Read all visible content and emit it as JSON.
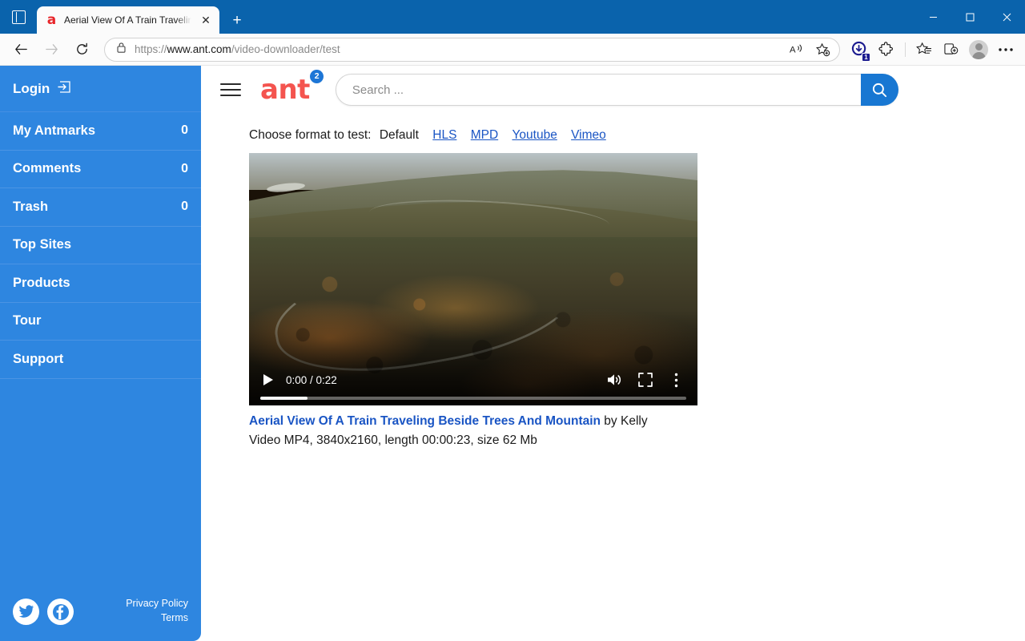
{
  "browser": {
    "tab": {
      "title": "Aerial View Of A Train Traveling B",
      "favicon_letter": "a",
      "close_label": "✕"
    },
    "newtab_label": "+",
    "address": {
      "url_prefix": "https://",
      "url_domain": "www.ant.com",
      "url_path": "/video-downloader/test"
    },
    "download_badge": "1",
    "window": {
      "minimize": "–",
      "maximize": "□",
      "close": "✕"
    }
  },
  "sidebar": {
    "login_label": "Login",
    "items": [
      {
        "label": "My Antmarks",
        "count": "0"
      },
      {
        "label": "Comments",
        "count": "0"
      },
      {
        "label": "Trash",
        "count": "0"
      },
      {
        "label": "Top Sites",
        "count": ""
      },
      {
        "label": "Products",
        "count": ""
      },
      {
        "label": "Tour",
        "count": ""
      },
      {
        "label": "Support",
        "count": ""
      }
    ],
    "footer": {
      "privacy": "Privacy Policy",
      "terms": "Terms"
    }
  },
  "header": {
    "logo_text": "ant",
    "logo_badge": "2",
    "search_placeholder": "Search ...",
    "search_value": ""
  },
  "main": {
    "format_prompt": "Choose format to test:",
    "format_current": "Default",
    "format_links": [
      "HLS",
      "MPD",
      "Youtube",
      "Vimeo"
    ],
    "video": {
      "time_display": "0:00 / 0:22",
      "current_time": "0:00",
      "duration": "0:22"
    },
    "caption": {
      "title": "Aerial View Of A Train Traveling Beside Trees And Mountain",
      "author": " by Kelly",
      "meta": "Video MP4, 3840x2160, length 00:00:23, size 62 Mb"
    }
  },
  "colors": {
    "titlebar": "#0a63ac",
    "sidebar": "#2e86e0",
    "logo_red": "#f4544f",
    "link_blue": "#1a55c4",
    "search_btn": "#1877d2"
  }
}
